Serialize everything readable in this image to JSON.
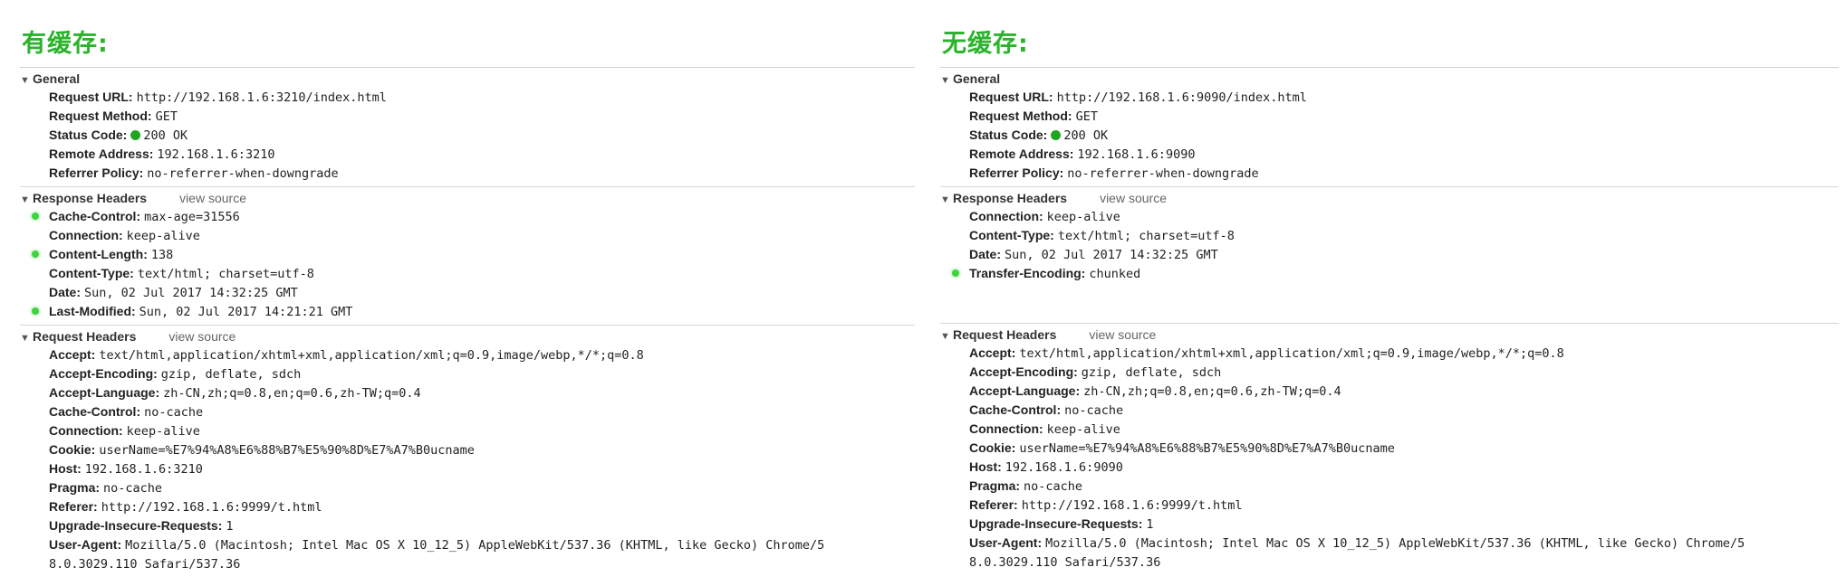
{
  "left": {
    "title": "有缓存:",
    "general": {
      "label": "General",
      "rows": [
        {
          "k": "Request URL:",
          "v": "http://192.168.1.6:3210/index.html"
        },
        {
          "k": "Request Method:",
          "v": "GET"
        },
        {
          "k": "Status Code:",
          "v": "200 OK",
          "status_dot": true
        },
        {
          "k": "Remote Address:",
          "v": "192.168.1.6:3210"
        },
        {
          "k": "Referrer Policy:",
          "v": "no-referrer-when-downgrade"
        }
      ]
    },
    "response": {
      "label": "Response Headers",
      "view_source": "view source",
      "rows": [
        {
          "k": "Cache-Control:",
          "v": "max-age=31556",
          "changed": true
        },
        {
          "k": "Connection:",
          "v": "keep-alive"
        },
        {
          "k": "Content-Length:",
          "v": "138",
          "changed": true
        },
        {
          "k": "Content-Type:",
          "v": "text/html; charset=utf-8"
        },
        {
          "k": "Date:",
          "v": "Sun, 02 Jul 2017 14:32:25 GMT"
        },
        {
          "k": "Last-Modified:",
          "v": "Sun, 02 Jul 2017 14:21:21 GMT",
          "changed": true
        }
      ]
    },
    "request": {
      "label": "Request Headers",
      "view_source": "view source",
      "rows": [
        {
          "k": "Accept:",
          "v": "text/html,application/xhtml+xml,application/xml;q=0.9,image/webp,*/*;q=0.8"
        },
        {
          "k": "Accept-Encoding:",
          "v": "gzip, deflate, sdch"
        },
        {
          "k": "Accept-Language:",
          "v": "zh-CN,zh;q=0.8,en;q=0.6,zh-TW;q=0.4"
        },
        {
          "k": "Cache-Control:",
          "v": "no-cache"
        },
        {
          "k": "Connection:",
          "v": "keep-alive"
        },
        {
          "k": "Cookie:",
          "v": "userName=%E7%94%A8%E6%88%B7%E5%90%8D%E7%A7%B0ucname"
        },
        {
          "k": "Host:",
          "v": "192.168.1.6:3210"
        },
        {
          "k": "Pragma:",
          "v": "no-cache"
        },
        {
          "k": "Referer:",
          "v": "http://192.168.1.6:9999/t.html"
        },
        {
          "k": "Upgrade-Insecure-Requests:",
          "v": "1"
        },
        {
          "k": "User-Agent:",
          "v": "Mozilla/5.0 (Macintosh; Intel Mac OS X 10_12_5) AppleWebKit/537.36 (KHTML, like Gecko) Chrome/5",
          "cont": "8.0.3029.110 Safari/537.36"
        }
      ]
    }
  },
  "right": {
    "title": "无缓存:",
    "general": {
      "label": "General",
      "rows": [
        {
          "k": "Request URL:",
          "v": "http://192.168.1.6:9090/index.html"
        },
        {
          "k": "Request Method:",
          "v": "GET"
        },
        {
          "k": "Status Code:",
          "v": "200 OK",
          "status_dot": true
        },
        {
          "k": "Remote Address:",
          "v": "192.168.1.6:9090"
        },
        {
          "k": "Referrer Policy:",
          "v": "no-referrer-when-downgrade"
        }
      ]
    },
    "response": {
      "label": "Response Headers",
      "view_source": "view source",
      "rows": [
        {
          "k": "Connection:",
          "v": "keep-alive"
        },
        {
          "k": "Content-Type:",
          "v": "text/html; charset=utf-8"
        },
        {
          "k": "Date:",
          "v": "Sun, 02 Jul 2017 14:32:25 GMT"
        },
        {
          "k": "Transfer-Encoding:",
          "v": "chunked",
          "changed": true
        }
      ]
    },
    "request": {
      "label": "Request Headers",
      "view_source": "view source",
      "rows": [
        {
          "k": "Accept:",
          "v": "text/html,application/xhtml+xml,application/xml;q=0.9,image/webp,*/*;q=0.8"
        },
        {
          "k": "Accept-Encoding:",
          "v": "gzip, deflate, sdch"
        },
        {
          "k": "Accept-Language:",
          "v": "zh-CN,zh;q=0.8,en;q=0.6,zh-TW;q=0.4"
        },
        {
          "k": "Cache-Control:",
          "v": "no-cache"
        },
        {
          "k": "Connection:",
          "v": "keep-alive"
        },
        {
          "k": "Cookie:",
          "v": "userName=%E7%94%A8%E6%88%B7%E5%90%8D%E7%A7%B0ucname"
        },
        {
          "k": "Host:",
          "v": "192.168.1.6:9090"
        },
        {
          "k": "Pragma:",
          "v": "no-cache"
        },
        {
          "k": "Referer:",
          "v": "http://192.168.1.6:9999/t.html"
        },
        {
          "k": "Upgrade-Insecure-Requests:",
          "v": "1"
        },
        {
          "k": "User-Agent:",
          "v": "Mozilla/5.0 (Macintosh; Intel Mac OS X 10_12_5) AppleWebKit/537.36 (KHTML, like Gecko) Chrome/5",
          "cont": "8.0.3029.110 Safari/537.36"
        }
      ]
    }
  },
  "colors": {
    "heading": "#2bb32b",
    "changed_dot": "#3ed43e",
    "status_dot": "#1fa51f"
  },
  "icons": {
    "collapse": "triangle-down-icon",
    "changed": "green-dot-icon",
    "status": "status-ok-icon"
  }
}
